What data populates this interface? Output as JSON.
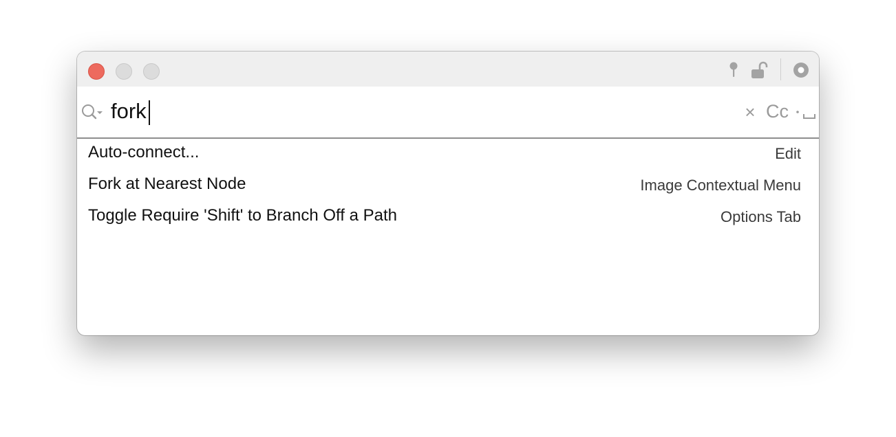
{
  "window": {
    "traffic_lights": [
      "close",
      "minimize",
      "zoom"
    ],
    "titlebar_icons": [
      "pin-icon",
      "unlock-icon",
      "options-icon"
    ]
  },
  "search": {
    "value": "fork",
    "placeholder": "",
    "case_toggle_label": "Cc",
    "icons": [
      "search-icon",
      "clear-icon",
      "whitespace-icon"
    ]
  },
  "results": [
    {
      "label": "Auto-connect...",
      "category": "Edit"
    },
    {
      "label": "Fork at Nearest Node",
      "category": "Image Contextual Menu"
    },
    {
      "label": "Toggle Require 'Shift' to Branch Off a Path",
      "category": "Options Tab"
    }
  ],
  "colors": {
    "close": "#ed6a5e",
    "titlebar": "#efefef",
    "muted": "#9a9a9a"
  }
}
